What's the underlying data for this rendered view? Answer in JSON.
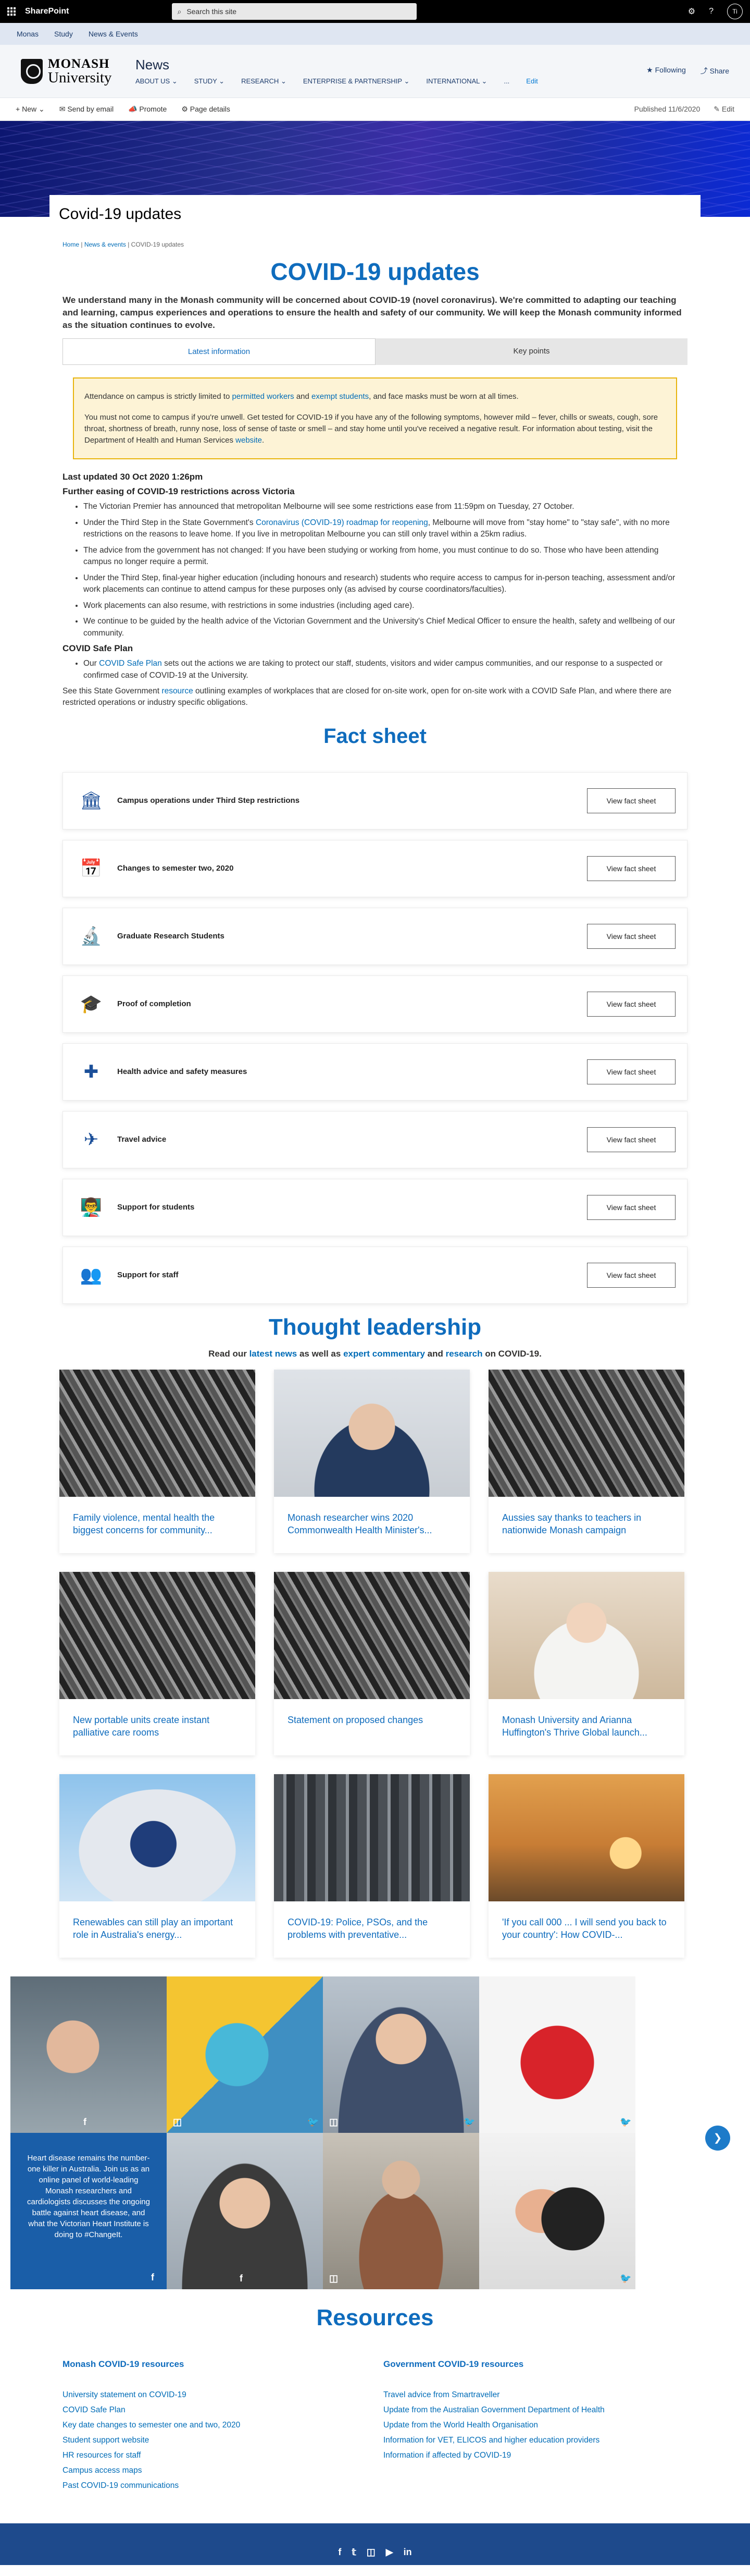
{
  "suite": {
    "name": "SharePoint",
    "search_placeholder": "Search this site",
    "avatar": "Ti"
  },
  "hub_nav": [
    "Monas",
    "Study",
    "News & Events"
  ],
  "site": {
    "logo_top": "MONASH",
    "logo_bottom": "University",
    "title": "News",
    "menu": [
      "ABOUT US",
      "STUDY",
      "RESEARCH",
      "ENTERPRISE & PARTNERSHIP",
      "INTERNATIONAL",
      "...",
      "Edit"
    ],
    "following": "Following",
    "share": "Share"
  },
  "command_bar": {
    "new": "New",
    "send": "Send by email",
    "promote": "Promote",
    "details": "Page details",
    "published": "Published 11/6/2020",
    "edit": "Edit"
  },
  "page_title": "Covid-19 updates",
  "breadcrumb": {
    "home": "Home",
    "news": "News & events",
    "current": "COVID-19 updates"
  },
  "heading": "COVID-19 updates",
  "intro": "We understand many in the Monash community will be concerned about COVID-19 (novel coronavirus). We're committed to adapting our teaching and learning, campus experiences and operations to ensure the health and safety of our community. We will keep the Monash community informed as the situation continues to evolve.",
  "tabs": [
    "Latest information",
    "Key points"
  ],
  "notice": {
    "p1_a": "Attendance on campus is strictly limited to ",
    "p1_link1": "permitted workers",
    "p1_b": " and ",
    "p1_link2": "exempt students",
    "p1_c": ", and face masks must be worn at all times.",
    "p2_a": "You must not come to campus if you're unwell. Get tested for COVID-19 if you have any of the following symptoms, however mild – fever, chills or sweats, cough, sore throat, shortness of breath, runny nose, loss of sense of taste or smell – and stay home until you've received a negative result. For information about testing, visit the Department of Health and Human Services ",
    "p2_link": "website",
    "p2_b": "."
  },
  "updated": "Last updated 30 Oct 2020 1:26pm",
  "easing_heading": "Further easing of COVID-19 restrictions across Victoria",
  "easing_points": [
    {
      "a": "The Victorian Premier has announced that metropolitan Melbourne will see some restrictions ease from 11:59pm on Tuesday, 27 October.",
      "link": "",
      "b": ""
    },
    {
      "a": "Under the Third Step in the State Government's ",
      "link": "Coronavirus (COVID-19) roadmap for reopening",
      "b": ", Melbourne will move from \"stay home\" to \"stay safe\", with no more restrictions on the reasons to leave home. If you live in metropolitan Melbourne you can still only travel within a 25km radius."
    },
    {
      "a": "The advice from the government has not changed: If you have been studying or working from home, you must continue to do so. Those who have been attending campus no longer require a permit.",
      "link": "",
      "b": ""
    },
    {
      "a": "Under the Third Step, final-year higher education (including honours and research) students who require access to campus for in-person teaching, assessment and/or work placements can continue to attend campus for these purposes only (as advised by course coordinators/faculties).",
      "link": "",
      "b": ""
    },
    {
      "a": "Work placements can also resume, with restrictions in some industries (including aged care).",
      "link": "",
      "b": ""
    },
    {
      "a": "We continue to be guided by the health advice of the Victorian Government and the University's Chief Medical Officer to ensure the health, safety and wellbeing of our community.",
      "link": "",
      "b": ""
    }
  ],
  "safe_plan": {
    "heading": "COVID Safe Plan",
    "a": "Our ",
    "link": "COVID Safe Plan",
    "b": " sets out the actions we are taking to protect our staff, students, visitors and wider campus communities, and our response to a suspected or confirmed case of COVID-19 at the University."
  },
  "state_gov": {
    "a": "See this State Government ",
    "link": "resource",
    "b": " outlining examples of workplaces that are closed for on-site work, open for on-site work with a COVID Safe Plan, and where there are restricted operations or industry specific obligations."
  },
  "fact_sheet": {
    "heading": "Fact sheet",
    "button": "View fact sheet",
    "items": [
      {
        "label": "Campus operations under Third Step restrictions",
        "icon": "building-icon",
        "glyph": "🏛"
      },
      {
        "label": "Changes to semester two, 2020",
        "icon": "calendar-icon",
        "glyph": "📅"
      },
      {
        "label": "Graduate Research Students",
        "icon": "microscope-icon",
        "glyph": "🔬"
      },
      {
        "label": "Proof of completion",
        "icon": "graduation-cap-icon",
        "glyph": "🎓"
      },
      {
        "label": "Health advice and safety measures",
        "icon": "first-aid-icon",
        "glyph": "✚"
      },
      {
        "label": "Travel advice",
        "icon": "plane-icon",
        "glyph": "✈"
      },
      {
        "label": "Support for students",
        "icon": "presentation-icon",
        "glyph": "👨‍🏫"
      },
      {
        "label": "Support for staff",
        "icon": "people-icon",
        "glyph": "👥"
      }
    ]
  },
  "thought": {
    "heading": "Thought leadership",
    "sub_a": "Read our ",
    "link1": "latest news",
    "sub_b": " as well as ",
    "link2": "expert commentary",
    "sub_c": " and ",
    "link3": "research",
    "sub_d": " on COVID-19.",
    "cards": [
      {
        "title": "Family violence, mental health the biggest concerns for community...",
        "img": "img-news"
      },
      {
        "title": "Monash researcher wins 2020 Commonwealth Health Minister's...",
        "img": "img-face"
      },
      {
        "title": "Aussies say thanks to teachers in nationwide Monash campaign",
        "img": "img-news"
      },
      {
        "title": "New portable units create instant palliative care rooms",
        "img": "img-news"
      },
      {
        "title": "Statement on proposed changes",
        "img": "img-news"
      },
      {
        "title": "Monash University and Arianna Huffington's Thrive Global launch...",
        "img": "img-woman"
      },
      {
        "title": "Renewables can still play an important role in Australia's energy...",
        "img": "img-gas"
      },
      {
        "title": "COVID-19: Police, PSOs, and the problems with preventative...",
        "img": "img-street"
      },
      {
        "title": "'If you call 000 ... I will send you back to your country': How COVID-...",
        "img": "img-sunset"
      }
    ]
  },
  "social": {
    "post": "Heart disease remains the number-one killer in Australia. Join us as an online panel of world-leading Monash researchers and cardiologists discusses the ongoing battle against heart disease, and what the Victorian Heart Institute is doing to #ChangeIt."
  },
  "resources": {
    "heading": "Resources",
    "monash_heading": "Monash COVID-19 resources",
    "monash_links": [
      "University statement on COVID-19",
      "COVID Safe Plan",
      "Key date changes to semester one and two, 2020",
      "Student support website",
      "HR resources for staff",
      "Campus access maps",
      "Past COVID-19 communications"
    ],
    "gov_heading": "Government COVID-19 resources",
    "gov_links": [
      "Travel advice from Smartraveller",
      "Update from the Australian Government Department of Health",
      "Update from the World Health Organisation",
      "Information for VET, ELICOS and higher education providers",
      "Information if affected by COVID-19"
    ]
  },
  "footer_social": [
    "f",
    "t",
    "ig",
    "yt",
    "in"
  ]
}
